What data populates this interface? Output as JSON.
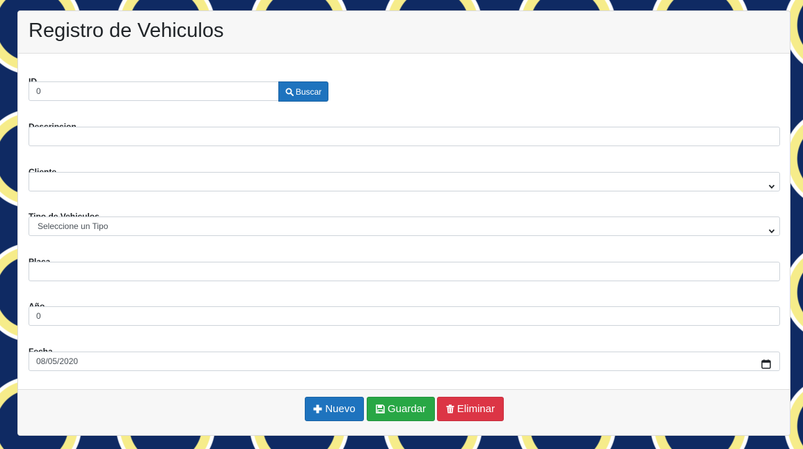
{
  "header": {
    "title": "Registro de Vehiculos"
  },
  "form": {
    "id": {
      "label": "ID",
      "value": "0"
    },
    "buscar_label": "Buscar",
    "descripcion": {
      "label": "Descripcion",
      "value": ""
    },
    "cliente": {
      "label": "Cliente",
      "selected": ""
    },
    "tipo": {
      "label": "Tipo de Vehiculos",
      "selected": "Seleccione un Tipo"
    },
    "placa": {
      "label": "Placa",
      "value": ""
    },
    "anio": {
      "label": "Año",
      "value": "0"
    },
    "fecha": {
      "label": "Fecha",
      "value": "08/05/2020"
    }
  },
  "footer": {
    "nuevo_label": "Nuevo",
    "guardar_label": "Guardar",
    "eliminar_label": "Eliminar"
  },
  "colors": {
    "primary": "#1e73be",
    "success": "#28a745",
    "danger": "#dc3545",
    "background_navy": "#0f2a63",
    "background_yellow": "#f6ec8a"
  },
  "icons": {
    "buscar": "search-icon",
    "nuevo": "plus-icon",
    "guardar": "save-icon",
    "eliminar": "trash-icon",
    "select": "chevron-down-icon",
    "fecha": "calendar-icon"
  }
}
